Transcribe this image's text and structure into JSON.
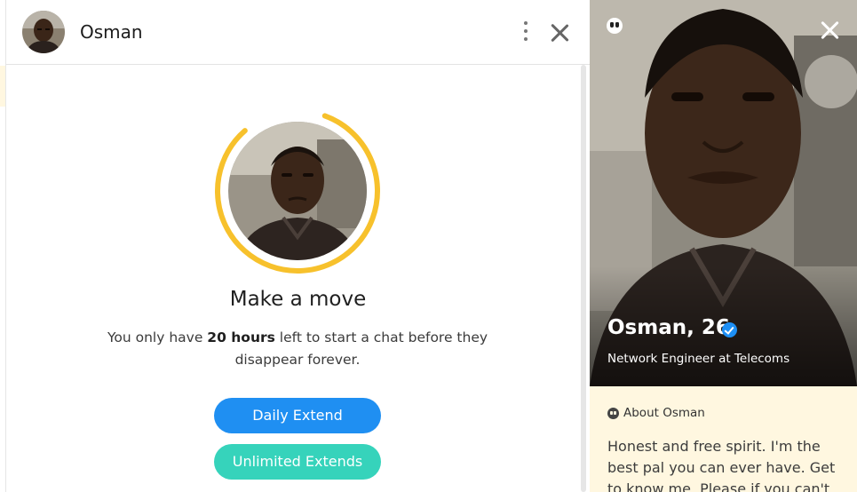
{
  "header": {
    "name": "Osman"
  },
  "main": {
    "heading": "Make a move",
    "desc_prefix": "You only have ",
    "desc_bold": "20 hours",
    "desc_suffix": " left to start a chat before they disappear forever.",
    "timer_remaining_fraction": 0.83,
    "daily_extend_label": "Daily Extend",
    "unlimited_extends_label": "Unlimited Extends"
  },
  "profile": {
    "name_age": "Osman, 26",
    "job": "Network Engineer at Telecoms",
    "about_title": "About Osman",
    "about_text": "Honest and free spirit. I'm the best pal you can ever have. Get to know me. Please if you can't"
  },
  "colors": {
    "timer_ring": "#f7c12c",
    "daily_extend": "#1f8ff2",
    "unlimited_extends": "#36d3bb",
    "profile_bg": "#fff7e0",
    "verified_badge": "#1d8ff5"
  }
}
